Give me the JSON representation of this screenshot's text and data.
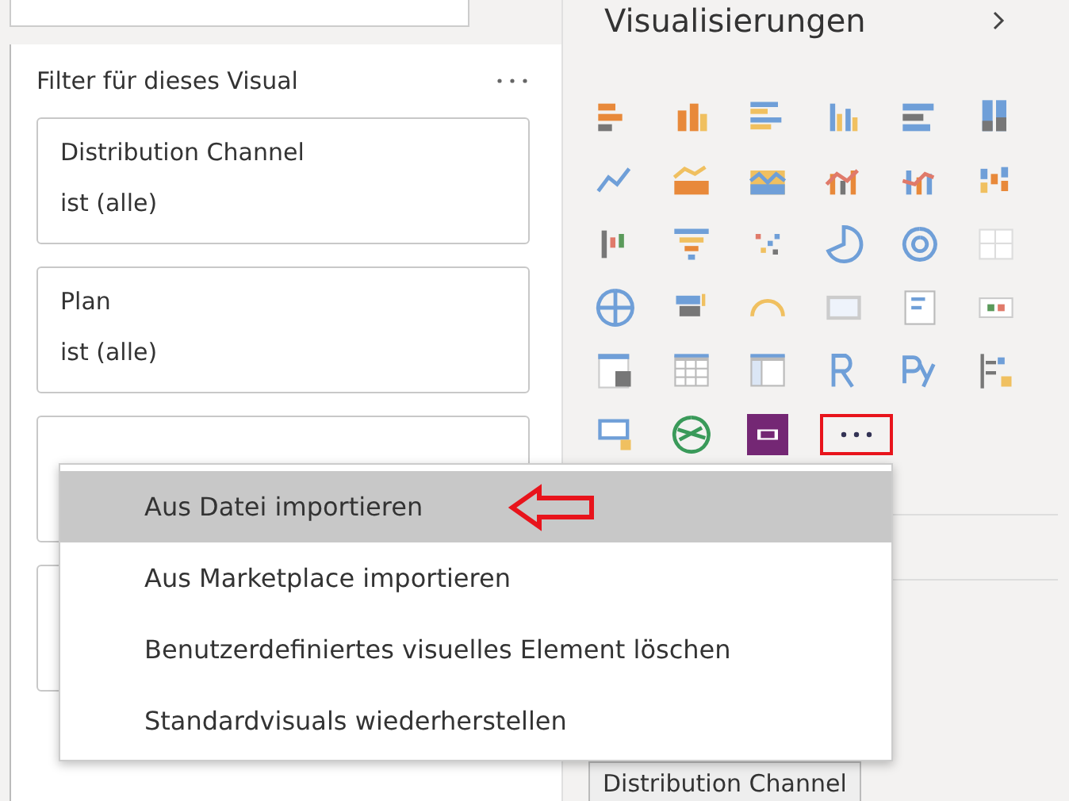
{
  "filter_pane": {
    "title": "Filter für dieses Visual",
    "cards": [
      {
        "field": "Distribution Channel",
        "condition": "ist (alle)"
      },
      {
        "field": "Plan",
        "condition": "ist (alle)"
      }
    ]
  },
  "visualizations": {
    "title": "Visualisierungen",
    "more_highlighted": true
  },
  "context_menu": {
    "items": [
      {
        "label": "Aus Datei importieren",
        "selected": true,
        "annotated": true
      },
      {
        "label": "Aus Marketplace importieren",
        "selected": false,
        "annotated": false
      },
      {
        "label": "Benutzerdefiniertes visuelles Element löschen",
        "selected": false,
        "annotated": false
      },
      {
        "label": "Standardvisuals wiederherstellen",
        "selected": false,
        "annotated": false
      }
    ]
  },
  "field_well": {
    "label": "Distribution Channel"
  }
}
